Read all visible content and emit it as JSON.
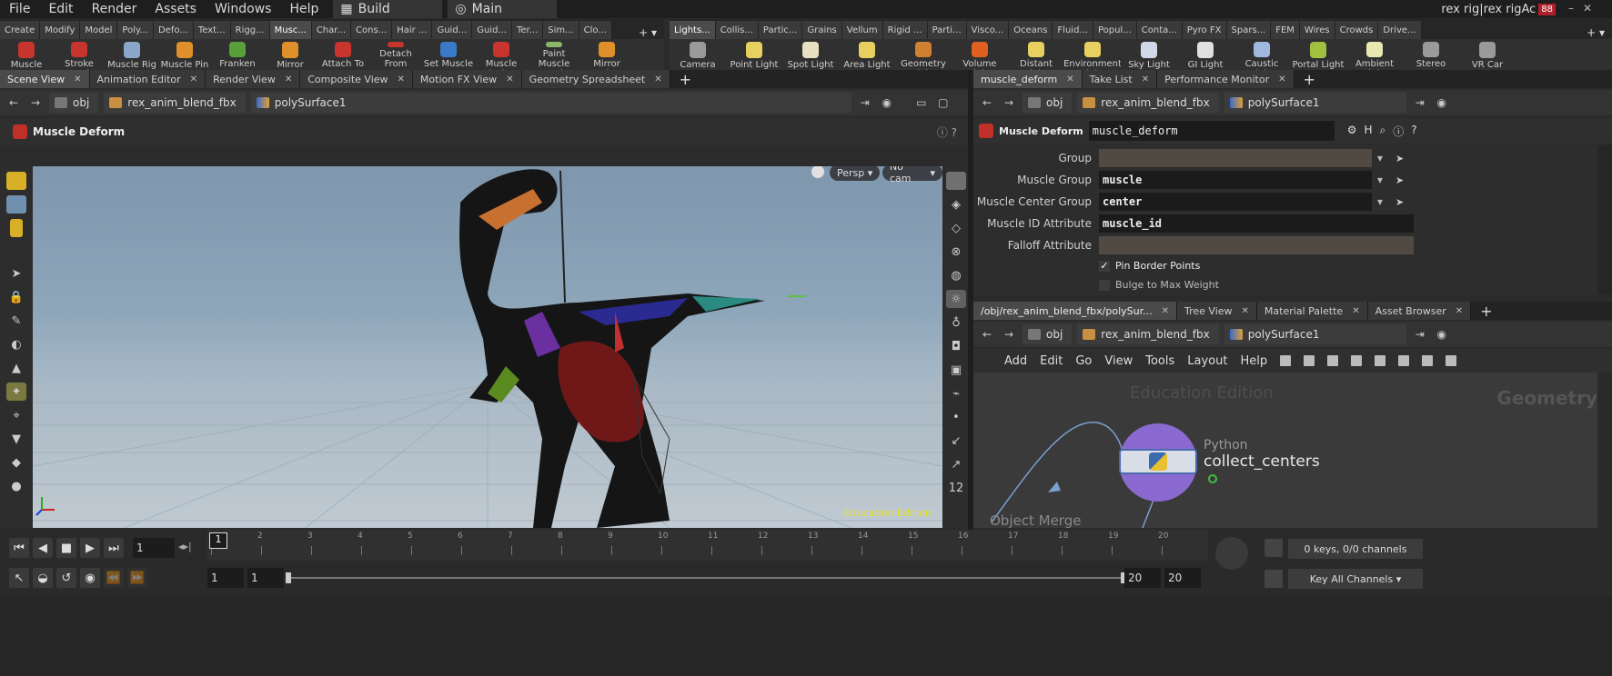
{
  "menu": {
    "items": [
      "File",
      "Edit",
      "Render",
      "Assets",
      "Windows",
      "Help"
    ],
    "desktop": "Build",
    "context": "Main",
    "rig_title": "rex rig|rex rigAc",
    "rig_badge": "88"
  },
  "shelf_tabs_left": [
    "Create",
    "Modify",
    "Model",
    "Poly...",
    "Defo...",
    "Text...",
    "Rigg...",
    "Musc...",
    "Char...",
    "Cons...",
    "Hair ...",
    "Guid...",
    "Guid...",
    "Ter...",
    "Sim...",
    "Clo..."
  ],
  "shelf_tabs_left_active": 7,
  "shelf_tabs_right": [
    "Lights...",
    "Collis...",
    "Partic...",
    "Grains",
    "Vellum",
    "Rigid ...",
    "Parti...",
    "Visco...",
    "Oceans",
    "Fluid...",
    "Popul...",
    "Conta...",
    "Pyro FX",
    "Spars...",
    "FEM",
    "Wires",
    "Crowds",
    "Drive..."
  ],
  "shelf_tabs_right_active": 0,
  "tools_left": [
    {
      "label": "Muscle",
      "color": "#c8342e"
    },
    {
      "label": "Stroke Muscle",
      "color": "#c8342e"
    },
    {
      "label": "Muscle Rig",
      "color": "#8aa6c8"
    },
    {
      "label": "Muscle Pin",
      "color": "#e0902a"
    },
    {
      "label": "Franken Muscle",
      "color": "#5aa03a"
    },
    {
      "label": "Mirror",
      "color": "#e0902a"
    },
    {
      "label": "Attach To Bones",
      "color": "#c8342e"
    },
    {
      "label": "Detach From Bones",
      "color": "#c8342e"
    },
    {
      "label": "Set Muscle ID",
      "color": "#3a7ac8"
    },
    {
      "label": "Muscle Displace",
      "color": "#c8342e"
    },
    {
      "label": "Paint Muscle Mask",
      "color": "#8ab86a"
    },
    {
      "label": "Mirror Muscle Ma",
      "color": "#e0902a"
    }
  ],
  "tools_right": [
    {
      "label": "Camera",
      "color": "#9a9a9a"
    },
    {
      "label": "Point Light",
      "color": "#e8d060"
    },
    {
      "label": "Spot Light",
      "color": "#e8e0c0"
    },
    {
      "label": "Area Light",
      "color": "#e8d060"
    },
    {
      "label": "Geometry Light",
      "color": "#d08030"
    },
    {
      "label": "Volume Light",
      "color": "#e06020"
    },
    {
      "label": "Distant Light",
      "color": "#e8d060"
    },
    {
      "label": "Environment Light",
      "color": "#e8d060"
    },
    {
      "label": "Sky Light",
      "color": "#d0d8e8"
    },
    {
      "label": "GI Light",
      "color": "#e0e0e0"
    },
    {
      "label": "Caustic Light",
      "color": "#a0b8e0"
    },
    {
      "label": "Portal Light",
      "color": "#a0c040"
    },
    {
      "label": "Ambient Light",
      "color": "#e8e8b0"
    },
    {
      "label": "Stereo Camera",
      "color": "#9a9a9a"
    },
    {
      "label": "VR Car",
      "color": "#9a9a9a"
    }
  ],
  "left_pane": {
    "tabs": [
      "Scene View",
      "Animation Editor",
      "Render View",
      "Composite View",
      "Motion FX View",
      "Geometry Spreadsheet"
    ],
    "path": [
      "obj",
      "rex_anim_blend_fbx",
      "polySurface1"
    ],
    "node_label": "Muscle Deform",
    "persp": "Persp",
    "cam": "No cam",
    "watermark": "Education Edition"
  },
  "right_top": {
    "tabs": [
      "muscle_deform",
      "Take List",
      "Performance Monitor"
    ],
    "path": [
      "obj",
      "rex_anim_blend_fbx",
      "polySurface1"
    ],
    "node_type": "Muscle Deform",
    "node_name": "muscle_deform",
    "params": [
      {
        "label": "Group",
        "value": ""
      },
      {
        "label": "Muscle Group",
        "value": "muscle"
      },
      {
        "label": "Muscle Center Group",
        "value": "center"
      },
      {
        "label": "Muscle ID Attribute",
        "value": "muscle_id"
      },
      {
        "label": "Falloff Attribute",
        "value": ""
      }
    ],
    "checks": [
      {
        "label": "Pin Border Points",
        "checked": true
      },
      {
        "label": "Bulge to Max Weight",
        "checked": false
      }
    ]
  },
  "right_bottom": {
    "tabs": [
      "/obj/rex_anim_blend_fbx/polySur...",
      "Tree View",
      "Material Palette",
      "Asset Browser"
    ],
    "path": [
      "obj",
      "rex_anim_blend_fbx",
      "polySurface1"
    ],
    "menu": [
      "Add",
      "Edit",
      "Go",
      "View",
      "Tools",
      "Layout",
      "Help"
    ],
    "watermark": "Education Edition",
    "context_label": "Geometry",
    "node_type": "Python",
    "node_name": "collect_centers",
    "other_node": "Object Merge"
  },
  "timeline": {
    "frame": "1",
    "ticks": [
      "1",
      "2",
      "3",
      "4",
      "5",
      "6",
      "7",
      "8",
      "9",
      "10",
      "11",
      "12",
      "13",
      "14",
      "15",
      "16",
      "17",
      "18",
      "19",
      "20"
    ],
    "start": "1",
    "start2": "1",
    "end": "20",
    "end2": "20",
    "keys_info": "0 keys, 0/0 channels",
    "key_channels": "Key All Channels"
  }
}
